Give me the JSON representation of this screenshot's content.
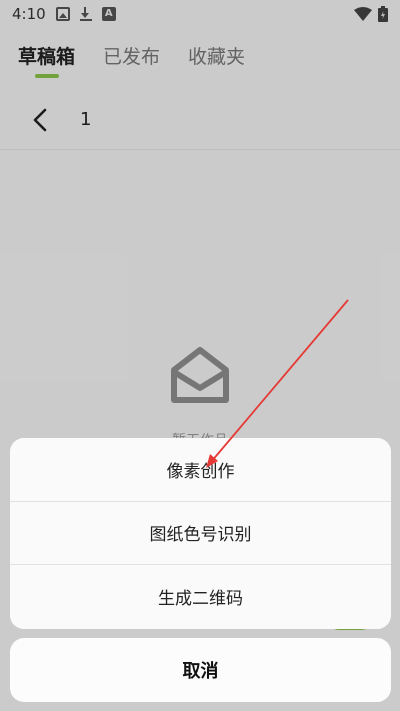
{
  "status_bar": {
    "time": "4:10",
    "a_badge": "A",
    "icons": [
      "image-icon",
      "download-icon",
      "a-badge-icon",
      "wifi-icon",
      "battery-icon"
    ]
  },
  "tabs": [
    {
      "label": "草稿箱",
      "active": true
    },
    {
      "label": "已发布",
      "active": false
    },
    {
      "label": "收藏夹",
      "active": false
    }
  ],
  "subheader": {
    "page_number": "1"
  },
  "empty_state": {
    "icon": "open-envelope-icon",
    "text": "暂无作品"
  },
  "action_sheet": {
    "items": [
      {
        "label": "像素创作"
      },
      {
        "label": "图纸色号识别"
      },
      {
        "label": "生成二维码"
      }
    ],
    "cancel_label": "取消"
  },
  "colors": {
    "accent": "#8bc34a",
    "annotation": "#e53935"
  }
}
